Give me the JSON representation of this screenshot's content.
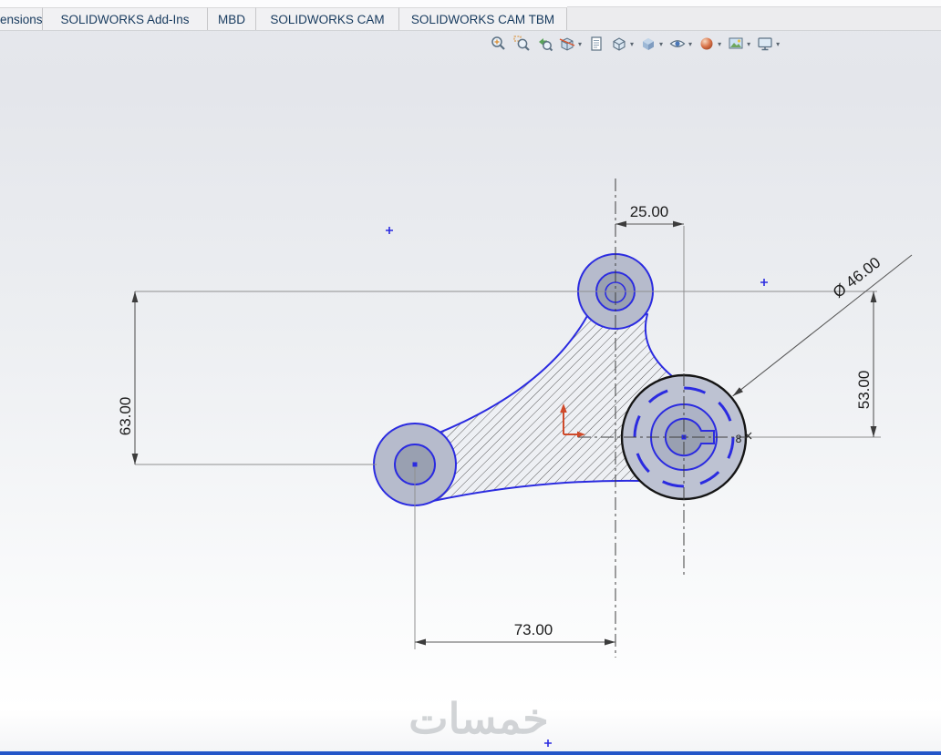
{
  "command_tabs": {
    "items": [
      {
        "label": "ensions"
      },
      {
        "label": "SOLIDWORKS Add-Ins"
      },
      {
        "label": "MBD"
      },
      {
        "label": "SOLIDWORKS CAM"
      },
      {
        "label": "SOLIDWORKS CAM TBM"
      }
    ]
  },
  "headsup_toolbar": {
    "icons": [
      "zoom-to-fit",
      "zoom-to-area",
      "previous-view",
      "section-view",
      "annotation-views",
      "view-orientation",
      "display-style",
      "hide-show-items",
      "edit-appearance",
      "apply-scene",
      "view-settings"
    ]
  },
  "sketch": {
    "dimensions": {
      "top_width": "25.00",
      "diameter": "Ø 46.00",
      "left_height": "63.00",
      "right_height": "53.00",
      "bottom_width": "73.00"
    },
    "labels": {
      "point": "8"
    },
    "colors": {
      "sketch_blue": "#2b2be0",
      "model_edge_black": "#151515",
      "dimension_text": "#1c1c1c",
      "extension_line": "#8f8f8f",
      "centerline": "#3f3f3f",
      "boss_fill": "#b6bbcc",
      "hole_fill": "#99a0b1",
      "hatch_line": "#4a4a4a",
      "origin_red": "#cf4a2a",
      "bottom_accent": "#2456c8"
    }
  },
  "watermark": {
    "text": "خمسات"
  }
}
